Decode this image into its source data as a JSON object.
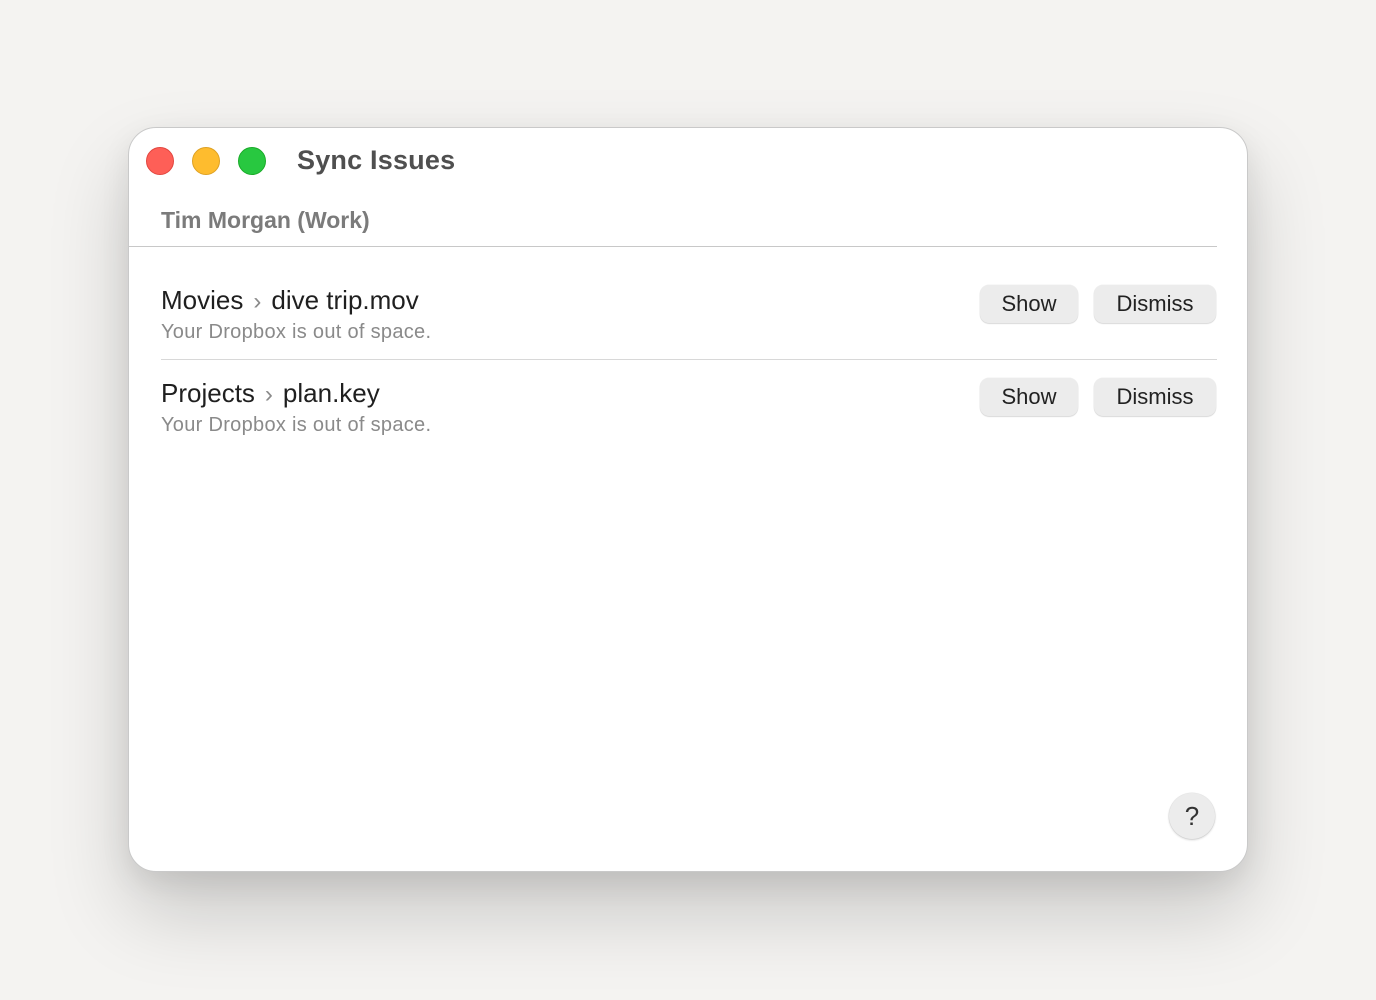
{
  "window": {
    "title": "Sync Issues",
    "traffic_lights": {
      "close": "close-button",
      "minimize": "minimize-button",
      "maximize": "zoom-button"
    }
  },
  "account": {
    "label": "Tim Morgan (Work)"
  },
  "issues": [
    {
      "folder": "Movies",
      "separator": "›",
      "file": "dive trip.mov",
      "message": "Your Dropbox is out of space.",
      "show_label": "Show",
      "dismiss_label": "Dismiss"
    },
    {
      "folder": "Projects",
      "separator": "›",
      "file": "plan.key",
      "message": "Your Dropbox is out of space.",
      "show_label": "Show",
      "dismiss_label": "Dismiss"
    }
  ],
  "help": {
    "label": "?"
  },
  "colors": {
    "close": "#fe5f57",
    "minimize": "#febc2e",
    "maximize": "#28c840"
  }
}
